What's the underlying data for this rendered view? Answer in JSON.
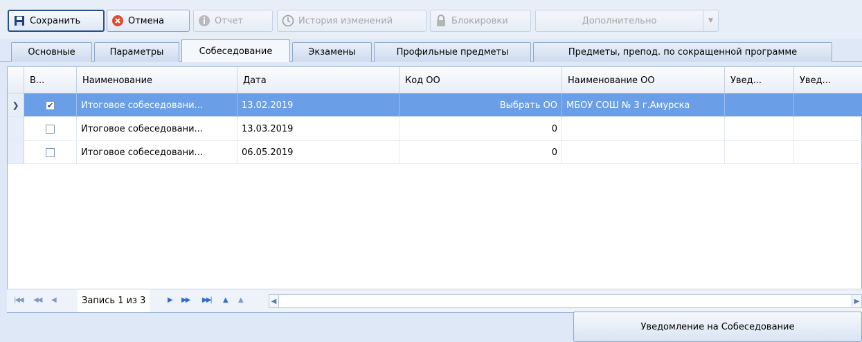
{
  "toolbar": {
    "save_label": "Сохранить",
    "cancel_label": "Отмена",
    "report_label": "Отчет",
    "history_label": "История изменений",
    "locks_label": "Блокировки",
    "more_label": "Дополнительно"
  },
  "tabs": [
    {
      "label": "Основные"
    },
    {
      "label": "Параметры"
    },
    {
      "label": "Собеседование"
    },
    {
      "label": "Экзамены"
    },
    {
      "label": "Профильные предметы"
    },
    {
      "label": "Предметы, препод. по сокращенной программе"
    }
  ],
  "active_tab": "Собеседование",
  "grid": {
    "columns": [
      "В...",
      "Наименование",
      "Дата",
      "Код ОО",
      "Наименование ОО",
      "Увед...",
      "Увед..."
    ],
    "rows": [
      {
        "checked": true,
        "name": "Итоговое собеседовани...",
        "date": "13.02.2019",
        "code": "Выбрать ОО",
        "org": "МБОУ СОШ № 3 г.Амурска",
        "n1": "",
        "n2": ""
      },
      {
        "checked": false,
        "name": "Итоговое собеседовани...",
        "date": "13.03.2019",
        "code": "0",
        "org": "",
        "n1": "",
        "n2": ""
      },
      {
        "checked": false,
        "name": "Итоговое собеседовани...",
        "date": "06.05.2019",
        "code": "0",
        "org": "",
        "n1": "",
        "n2": ""
      }
    ]
  },
  "navigator": {
    "record_text": "Запись 1 из 3"
  },
  "notify_button": "Уведомление на Собеседование"
}
